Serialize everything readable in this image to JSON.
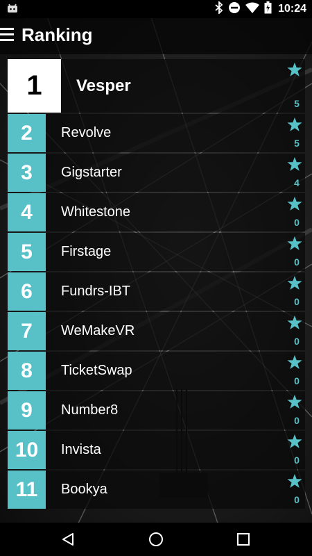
{
  "status": {
    "time": "10:24"
  },
  "header": {
    "title": "Ranking"
  },
  "colors": {
    "accent": "#58c1c8",
    "first_rank_bg": "#ffffff"
  },
  "ranking": [
    {
      "rank": "1",
      "name": "Vesper",
      "votes": "5"
    },
    {
      "rank": "2",
      "name": "Revolve",
      "votes": "5"
    },
    {
      "rank": "3",
      "name": "Gigstarter",
      "votes": "4"
    },
    {
      "rank": "4",
      "name": "Whitestone",
      "votes": "0"
    },
    {
      "rank": "5",
      "name": "Firstage",
      "votes": "0"
    },
    {
      "rank": "6",
      "name": "Fundrs-IBT",
      "votes": "0"
    },
    {
      "rank": "7",
      "name": "WeMakeVR",
      "votes": "0"
    },
    {
      "rank": "8",
      "name": "TicketSwap",
      "votes": "0"
    },
    {
      "rank": "9",
      "name": "Number8",
      "votes": "0"
    },
    {
      "rank": "10",
      "name": "Invista",
      "votes": "0"
    },
    {
      "rank": "11",
      "name": "Bookya",
      "votes": "0"
    }
  ],
  "icons": {
    "menu": "menu-icon",
    "vote": "star-icon",
    "nav_back": "back-triangle-icon",
    "nav_home": "home-circle-icon",
    "nav_recents": "recents-square-icon"
  }
}
